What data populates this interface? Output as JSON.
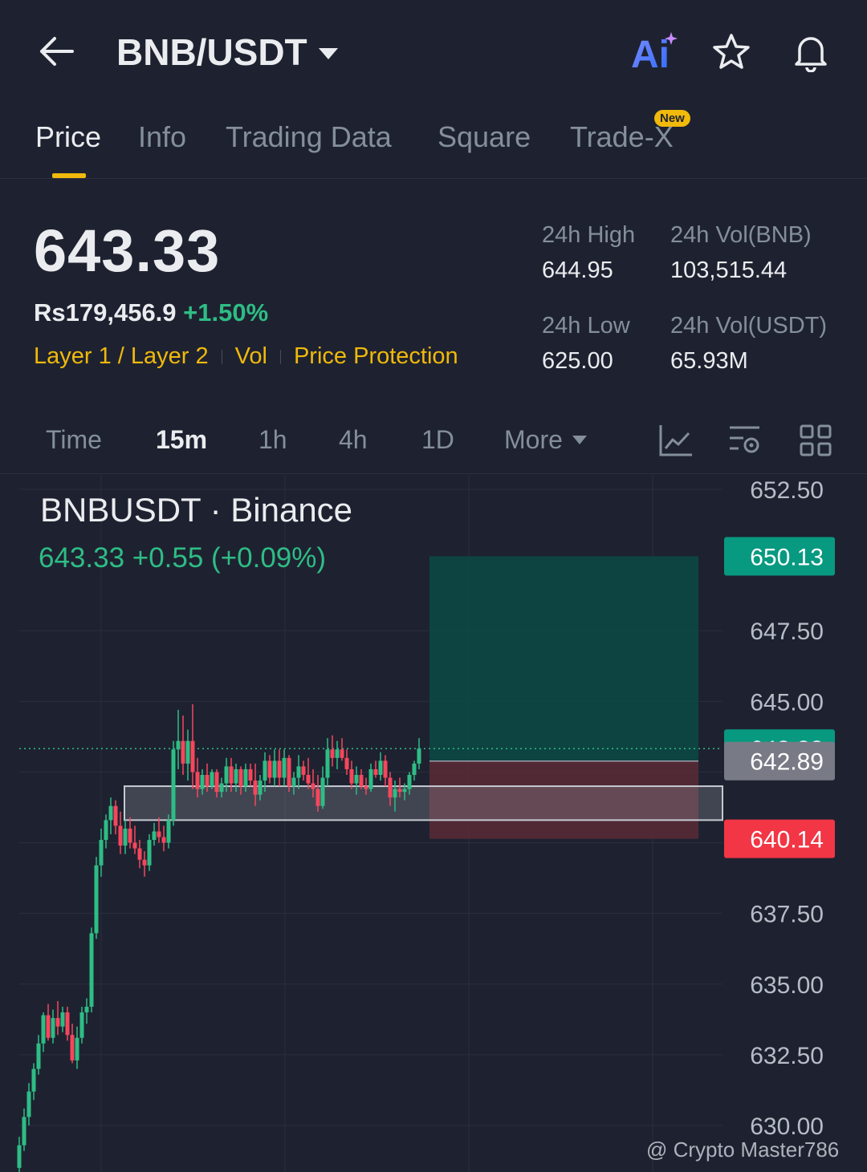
{
  "header": {
    "pair": "BNB/USDT",
    "icons": [
      "back-arrow-icon",
      "ai-icon",
      "star-icon",
      "bell-icon"
    ],
    "ai_label": "Ai"
  },
  "tabs": [
    {
      "label": "Price",
      "active": true
    },
    {
      "label": "Info",
      "active": false
    },
    {
      "label": "Trading Data",
      "active": false
    },
    {
      "label": "Square",
      "active": false
    },
    {
      "label": "Trade-X",
      "active": false,
      "badge": "New"
    }
  ],
  "ticker": {
    "last_price": "643.33",
    "fiat_price": "Rs179,456.9",
    "change_pct": "+1.50%",
    "tags": [
      "Layer 1 / Layer 2",
      "Vol",
      "Price Protection"
    ],
    "high_label": "24h High",
    "high_value": "644.95",
    "vol_base_label": "24h Vol(BNB)",
    "vol_base_value": "103,515.44",
    "low_label": "24h Low",
    "low_value": "625.00",
    "vol_quote_label": "24h Vol(USDT)",
    "vol_quote_value": "65.93M"
  },
  "timeframes": {
    "items": [
      "Time",
      "15m",
      "1h",
      "4h",
      "1D"
    ],
    "active": "15m",
    "more_label": "More",
    "tool_icons": [
      "indicator-chart-icon",
      "settings-chart-icon",
      "grid-layout-icon"
    ]
  },
  "chart_header": {
    "title": "BNBUSDT · Binance",
    "quote": "643.33  +0.55 (+0.09%)"
  },
  "colors": {
    "up": "#2ebd85",
    "down": "#f6465d",
    "accent": "#f0b90b",
    "background": "#1e2230"
  },
  "chart_data": {
    "type": "candlestick",
    "title": "BNBUSDT · Binance",
    "ylim": [
      629.3,
      653.1
    ],
    "y_ticks": [
      "652.50",
      "647.50",
      "645.00",
      "637.50",
      "635.00",
      "632.50",
      "630.00"
    ],
    "y_tick_values": [
      652.5,
      647.5,
      645.0,
      637.5,
      635.0,
      632.5,
      630.0
    ],
    "price_tags": [
      {
        "label": "650.13",
        "value": 650.13,
        "color": "#089981"
      },
      {
        "label": "643.33",
        "value": 643.33,
        "color": "#089981"
      },
      {
        "label": "642.89",
        "value": 642.89,
        "color": "#787b86"
      },
      {
        "label": "640.14",
        "value": 640.14,
        "color": "#f23645"
      }
    ],
    "last_price_line": 643.33,
    "position": {
      "entry": 642.89,
      "take_profit": 650.13,
      "stop_loss": 640.14,
      "start_index": 59,
      "end_index": 96
    },
    "support_zone": {
      "top": 642.0,
      "bottom": 640.8,
      "start_index": 14
    },
    "candles": [
      [
        628.5,
        629.6,
        628.2,
        629.3
      ],
      [
        629.3,
        630.6,
        629.1,
        630.3
      ],
      [
        630.3,
        631.5,
        630.0,
        631.2
      ],
      [
        631.2,
        632.2,
        630.9,
        632.0
      ],
      [
        632.0,
        633.2,
        631.8,
        632.9
      ],
      [
        632.9,
        634.0,
        632.6,
        633.9
      ],
      [
        633.9,
        634.3,
        633.0,
        633.1
      ],
      [
        633.1,
        634.1,
        632.9,
        633.8
      ],
      [
        633.8,
        634.4,
        633.2,
        633.5
      ],
      [
        633.5,
        634.2,
        633.3,
        634.0
      ],
      [
        634.0,
        634.2,
        633.0,
        633.2
      ],
      [
        633.2,
        633.6,
        632.2,
        632.3
      ],
      [
        632.3,
        633.5,
        632.0,
        633.1
      ],
      [
        633.1,
        634.2,
        632.9,
        634.0
      ],
      [
        634.0,
        634.5,
        633.6,
        634.2
      ],
      [
        634.2,
        637.0,
        634.0,
        636.8
      ],
      [
        636.8,
        639.5,
        636.6,
        639.2
      ],
      [
        639.2,
        640.5,
        638.8,
        640.1
      ],
      [
        640.1,
        641.0,
        639.8,
        640.8
      ],
      [
        640.8,
        641.6,
        640.3,
        641.3
      ],
      [
        641.3,
        641.5,
        640.3,
        640.6
      ],
      [
        640.6,
        641.1,
        639.6,
        639.9
      ],
      [
        639.9,
        640.8,
        639.6,
        640.5
      ],
      [
        640.5,
        640.9,
        639.8,
        640.0
      ],
      [
        640.0,
        640.6,
        639.6,
        639.8
      ],
      [
        639.8,
        640.1,
        639.1,
        639.4
      ],
      [
        639.4,
        639.7,
        638.8,
        639.2
      ],
      [
        639.2,
        640.3,
        639.0,
        640.1
      ],
      [
        640.1,
        640.7,
        639.9,
        640.4
      ],
      [
        640.4,
        640.9,
        640.0,
        640.2
      ],
      [
        640.2,
        640.6,
        639.7,
        640.0
      ],
      [
        640.0,
        641.0,
        639.8,
        640.8
      ],
      [
        640.8,
        643.6,
        640.6,
        643.3
      ],
      [
        643.3,
        644.7,
        642.6,
        643.6
      ],
      [
        643.6,
        644.5,
        642.4,
        642.8
      ],
      [
        642.8,
        644.0,
        642.2,
        643.6
      ],
      [
        643.6,
        644.9,
        641.9,
        642.5
      ],
      [
        642.5,
        643.0,
        641.6,
        641.9
      ],
      [
        641.9,
        642.6,
        641.7,
        642.4
      ],
      [
        642.4,
        642.8,
        641.8,
        642.0
      ],
      [
        642.0,
        642.6,
        641.9,
        642.5
      ],
      [
        642.5,
        642.6,
        641.6,
        641.8
      ],
      [
        641.8,
        642.3,
        641.6,
        642.1
      ],
      [
        642.1,
        643.0,
        641.8,
        642.7
      ],
      [
        642.7,
        643.0,
        641.8,
        642.1
      ],
      [
        642.1,
        642.8,
        641.8,
        642.6
      ],
      [
        642.6,
        642.7,
        641.7,
        642.0
      ],
      [
        642.0,
        642.8,
        641.8,
        642.6
      ],
      [
        642.6,
        642.8,
        642.0,
        642.2
      ],
      [
        642.2,
        642.8,
        641.3,
        641.7
      ],
      [
        641.7,
        642.4,
        641.5,
        642.2
      ],
      [
        642.2,
        643.2,
        641.8,
        642.9
      ],
      [
        642.9,
        643.1,
        642.1,
        642.3
      ],
      [
        642.3,
        643.3,
        642.0,
        642.9
      ],
      [
        642.9,
        643.3,
        642.0,
        642.3
      ],
      [
        642.3,
        643.3,
        642.0,
        643.0
      ],
      [
        643.0,
        643.1,
        641.8,
        642.0
      ],
      [
        642.0,
        642.5,
        641.7,
        642.3
      ],
      [
        642.3,
        643.1,
        641.9,
        642.7
      ],
      [
        642.7,
        642.9,
        642.2,
        642.4
      ],
      [
        642.4,
        643.0,
        641.9,
        642.1
      ],
      [
        642.1,
        642.6,
        641.6,
        641.9
      ],
      [
        641.9,
        642.4,
        641.1,
        641.3
      ],
      [
        641.3,
        642.7,
        641.2,
        642.3
      ],
      [
        642.3,
        643.7,
        642.0,
        643.3
      ],
      [
        643.3,
        643.8,
        642.7,
        643.0
      ],
      [
        643.0,
        643.6,
        642.6,
        643.3
      ],
      [
        643.3,
        643.7,
        642.9,
        643.0
      ],
      [
        643.0,
        643.3,
        642.4,
        642.6
      ],
      [
        642.6,
        642.9,
        641.9,
        642.1
      ],
      [
        642.1,
        642.7,
        641.7,
        642.4
      ],
      [
        642.4,
        642.6,
        641.9,
        642.0
      ],
      [
        642.0,
        642.3,
        641.7,
        641.9
      ],
      [
        641.9,
        642.8,
        641.8,
        642.6
      ],
      [
        642.6,
        642.9,
        642.3,
        642.4
      ],
      [
        642.4,
        643.2,
        642.2,
        642.9
      ],
      [
        642.9,
        643.1,
        642.0,
        642.3
      ],
      [
        642.3,
        642.5,
        641.3,
        641.6
      ],
      [
        641.6,
        642.2,
        641.1,
        641.9
      ],
      [
        641.9,
        642.3,
        641.6,
        641.8
      ],
      [
        641.8,
        642.1,
        641.5,
        641.9
      ],
      [
        641.9,
        642.5,
        641.7,
        642.4
      ],
      [
        642.4,
        642.9,
        642.2,
        642.8
      ],
      [
        642.8,
        643.7,
        642.6,
        643.33
      ]
    ]
  },
  "watermark": "@ Crypto Master786"
}
